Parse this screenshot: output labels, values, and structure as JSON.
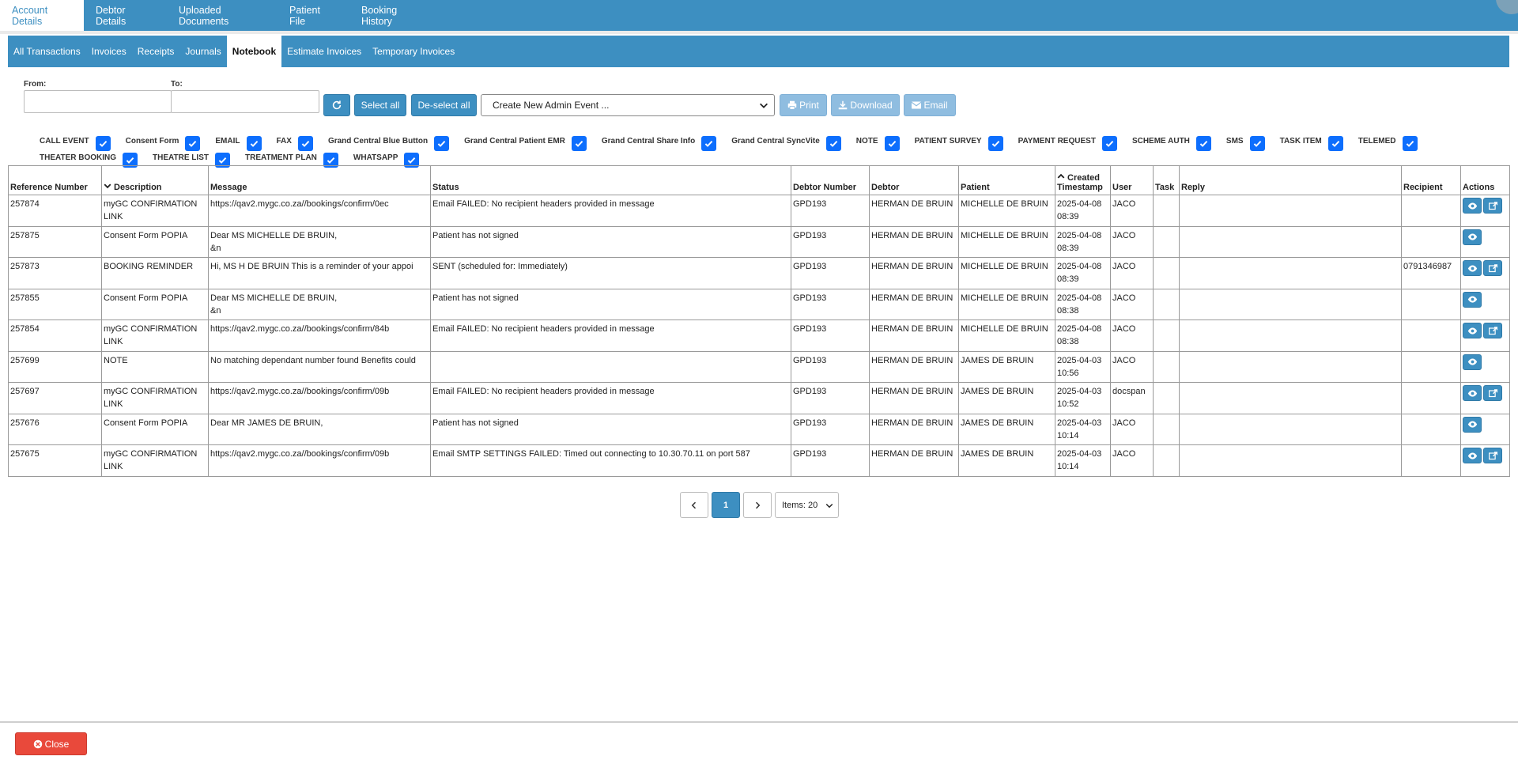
{
  "top_tabs": [
    "Account Details",
    "Debtor Details",
    "Uploaded Documents",
    "Patient File",
    "Booking History"
  ],
  "sub_tabs": [
    "All Transactions",
    "Invoices",
    "Receipts",
    "Journals",
    "Notebook",
    "Estimate Invoices",
    "Temporary Invoices"
  ],
  "filters": {
    "from_label": "From:",
    "to_label": "To:",
    "from_value": "",
    "to_value": ""
  },
  "toolbar": {
    "select_all": "Select all",
    "deselect_all": "De-select all",
    "admin_event": "Create New Admin Event ...",
    "print": "Print",
    "download": "Download",
    "email": "Email"
  },
  "event_types": [
    [
      "CALL EVENT",
      "Consent Form",
      "EMAIL",
      "FAX",
      "Grand Central Blue Button",
      "Grand Central Patient EMR",
      "Grand Central Share Info",
      "Grand Central SyncVite",
      "NOTE",
      "PATIENT SURVEY",
      "PAYMENT REQUEST",
      "SCHEME AUTH",
      "SMS",
      "TASK ITEM",
      "TELEMED"
    ],
    [
      "THEATER BOOKING",
      "THEATRE LIST",
      "TREATMENT PLAN",
      "WHATSAPP"
    ]
  ],
  "table": {
    "columns": [
      "Reference Number",
      "Description",
      "Message",
      "Status",
      "Debtor Number",
      "Debtor",
      "Patient",
      "Created Timestamp",
      "User",
      "Task",
      "Reply",
      "Recipient",
      "Actions"
    ],
    "rows": [
      [
        "257874",
        "myGC CONFIRMATION LINK",
        "https://qav2.mygc.co.za//bookings/confirm/0ec",
        "Email FAILED: No recipient headers provided in message",
        "GPD193",
        "HERMAN DE BRUIN",
        "MICHELLE DE BRUIN",
        "2025-04-08 08:39",
        "JACO",
        "",
        "",
        ""
      ],
      [
        "257875",
        "Consent Form POPIA",
        "Dear MS MICHELLE DE BRUIN,\n&n",
        "Patient has not signed",
        "GPD193",
        "HERMAN DE BRUIN",
        "MICHELLE DE BRUIN",
        "2025-04-08 08:39",
        "JACO",
        "",
        "",
        ""
      ],
      [
        "257873",
        "BOOKING REMINDER",
        "Hi, MS H DE BRUIN This is a reminder of your appoi",
        "SENT (scheduled for: Immediately)",
        "GPD193",
        "HERMAN DE BRUIN",
        "MICHELLE DE BRUIN",
        "2025-04-08 08:39",
        "JACO",
        "",
        "",
        "0791346987"
      ],
      [
        "257855",
        "Consent Form POPIA",
        "Dear MS MICHELLE DE BRUIN,\n&n",
        "Patient has not signed",
        "GPD193",
        "HERMAN DE BRUIN",
        "MICHELLE DE BRUIN",
        "2025-04-08 08:38",
        "JACO",
        "",
        "",
        ""
      ],
      [
        "257854",
        "myGC CONFIRMATION LINK",
        "https://qav2.mygc.co.za//bookings/confirm/84b",
        "Email FAILED: No recipient headers provided in message",
        "GPD193",
        "HERMAN DE BRUIN",
        "MICHELLE DE BRUIN",
        "2025-04-08 08:38",
        "JACO",
        "",
        "",
        ""
      ],
      [
        "257699",
        "NOTE",
        "No matching dependant number found Benefits could",
        "",
        "GPD193",
        "HERMAN DE BRUIN",
        "JAMES DE BRUIN",
        "2025-04-03 10:56",
        "JACO",
        "",
        "",
        ""
      ],
      [
        "257697",
        "myGC CONFIRMATION LINK",
        "https://qav2.mygc.co.za//bookings/confirm/09b",
        "Email FAILED: No recipient headers provided in message",
        "GPD193",
        "HERMAN DE BRUIN",
        "JAMES DE BRUIN",
        "2025-04-03 10:52",
        "docspan",
        "",
        "",
        ""
      ],
      [
        "257676",
        "Consent Form POPIA",
        "Dear MR JAMES DE BRUIN,",
        "Patient has not signed",
        "GPD193",
        "HERMAN DE BRUIN",
        "JAMES DE BRUIN",
        "2025-04-03 10:14",
        "JACO",
        "",
        "",
        ""
      ],
      [
        "257675",
        "myGC CONFIRMATION LINK",
        "https://qav2.mygc.co.za//bookings/confirm/09b",
        "Email SMTP SETTINGS FAILED: Timed out connecting to 10.30.70.11 on port 587",
        "GPD193",
        "HERMAN DE BRUIN",
        "JAMES DE BRUIN",
        "2025-04-03 10:14",
        "JACO",
        "",
        "",
        ""
      ]
    ],
    "row_actions": [
      "view+share",
      "view",
      "view+share",
      "view",
      "view+share",
      "view",
      "view+share",
      "view",
      "view+share"
    ]
  },
  "pagination": {
    "current_page": "1",
    "items_label": "Items: 20"
  },
  "footer": {
    "close": "Close"
  },
  "colors": {
    "primary": "#3d8fc1",
    "checkbox": "#0d6efd",
    "danger": "#e9493b"
  }
}
